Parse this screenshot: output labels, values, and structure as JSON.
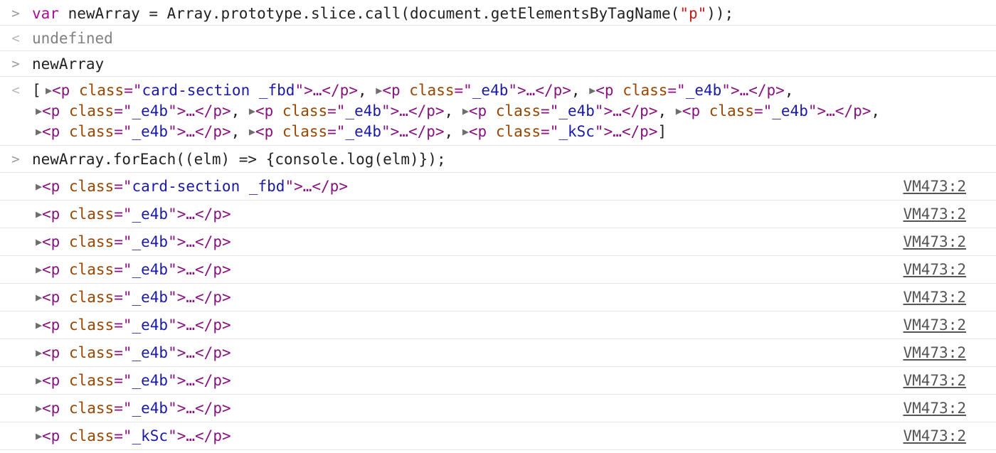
{
  "prompt_symbol": ">",
  "result_symbol": "<",
  "tree_arrow": "▶",
  "entry1": {
    "keyword": "var",
    "rest_before": " newArray = Array.prototype.slice.call(document.getElementsByTagName(",
    "string": "\"p\"",
    "rest_after": "));",
    "result": "undefined"
  },
  "entry2": {
    "input": "newArray",
    "array_items": [
      "card-section _fbd",
      "_e4b",
      "_e4b",
      "_e4b",
      "_e4b",
      "_e4b",
      "_e4b",
      "_e4b",
      "_e4b",
      "_kSc"
    ]
  },
  "entry3": {
    "input": "newArray.forEach((elm) => {console.log(elm)});",
    "logs": [
      {
        "class_value": "card-section _fbd",
        "source": "VM473:2"
      },
      {
        "class_value": "_e4b",
        "source": "VM473:2"
      },
      {
        "class_value": "_e4b",
        "source": "VM473:2"
      },
      {
        "class_value": "_e4b",
        "source": "VM473:2"
      },
      {
        "class_value": "_e4b",
        "source": "VM473:2"
      },
      {
        "class_value": "_e4b",
        "source": "VM473:2"
      },
      {
        "class_value": "_e4b",
        "source": "VM473:2"
      },
      {
        "class_value": "_e4b",
        "source": "VM473:2"
      },
      {
        "class_value": "_e4b",
        "source": "VM473:2"
      },
      {
        "class_value": "_kSc",
        "source": "VM473:2"
      }
    ]
  },
  "html": {
    "open_tag": "<p",
    "attr_name": "class",
    "equals_quote": "=\"",
    "close_quote": "\"",
    "gt_ellipsis": ">…",
    "close_tag": "</p>"
  }
}
